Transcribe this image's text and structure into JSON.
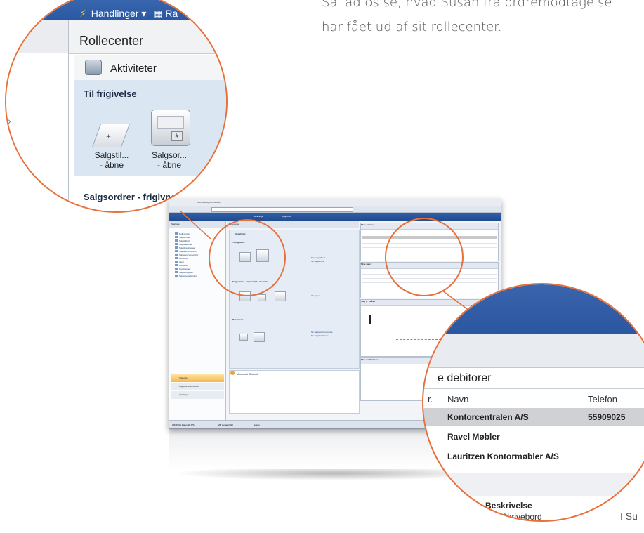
{
  "intro": {
    "line1": "Så lad os se, hvad Susan fra ordremodtagelse",
    "line2": "har fået ud af sit rollecenter."
  },
  "caption": "I Su",
  "magnifier_left": {
    "menu_label": "Handlinger",
    "menu_arrow": "▾",
    "extra_label": "Ra",
    "page_title": "Rollecenter",
    "activities_label": "Aktiviteter",
    "section_release": "Til frigivelse",
    "tile1_label_line1": "Salgstil...",
    "tile1_label_line2": "- åbne",
    "tile2_label_line1": "Salgsor...",
    "tile2_label_line2": "- åbne",
    "section_release_orders": "Salgsordrer - frigivne",
    "printer_mark": "#"
  },
  "magnifier_right": {
    "heading": "e debitorer",
    "columns": {
      "truncated": "r.",
      "name": "Navn",
      "phone": "Telefon"
    },
    "rows": [
      {
        "name": "Kontorcentralen A/S",
        "phone": "55909025",
        "selected": true
      },
      {
        "name": "Ravel Møbler",
        "phone": "",
        "selected": false
      },
      {
        "name": "Lauritzen Kontormøbler A/S",
        "phone": "",
        "selected": false
      }
    ],
    "section2": "rer",
    "desc_col": "Beskrivelse",
    "bottom_text": "TEN Skrivebord"
  },
  "mini_screenshot": {
    "window_title": "Microsoft Dynamics NAV",
    "cmd_item1": "Handlinger",
    "cmd_item2": "Rapporter",
    "nav_header": "Startside",
    "rc_header": "Rollecenter",
    "nav_items": [
      "Rollecenter",
      "Salgsordrer",
      "Salgstilbud",
      "Salgsfakturaer",
      "Salgskreditnotaer",
      "Salgsrammeordrer",
      "Salgsreturvareordrer",
      "Debitorer",
      "Varer",
      "Kontakter",
      "Kreditnotaer",
      "Salgsbudgetter",
      "Salgsmedarbejdere"
    ],
    "nav_buttons": [
      "Startside",
      "Bogførte dokumenter",
      "Afdelinger"
    ],
    "activities": "Aktiviteter",
    "section1": "Til frigivelse",
    "section2": "Salgsordrer - frigivne ikke afsendte",
    "section3": "Returneret",
    "links1": [
      "Nyt salgstilbud",
      "Ny salgsordre"
    ],
    "links2": [
      "Vis lager"
    ],
    "links3": [
      "Ny salgsreturvareordre",
      "Ny salgskreditnota"
    ],
    "outlook": "Microsoft Outlook",
    "right_panel1": "Mine debitorer",
    "right_panel2": "Mine varer",
    "right_panel3": "Salg pr. måned",
    "right_panel4": "Mine notifikationer",
    "status": [
      "CRONUS Danmark A/S",
      "26. januar 2010",
      "Susan"
    ]
  }
}
